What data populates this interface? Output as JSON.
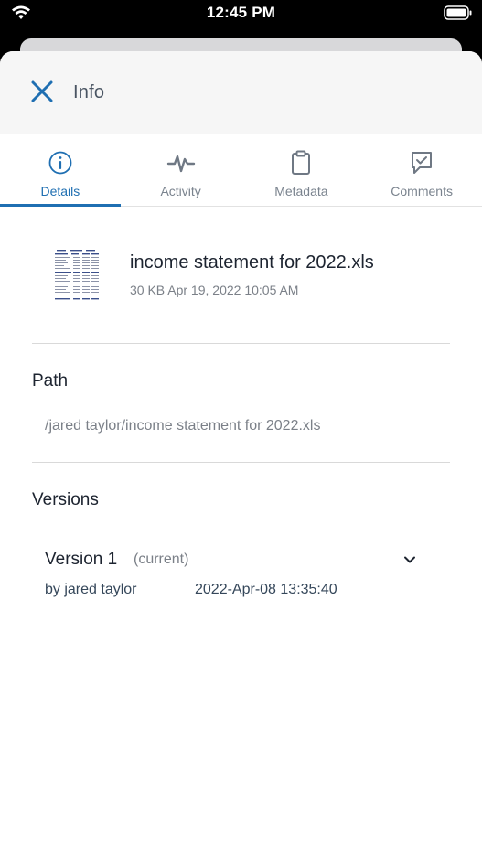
{
  "status_bar": {
    "time": "12:45 PM",
    "wifi_icon": "wifi-icon",
    "battery_icon": "battery-icon"
  },
  "header": {
    "title": "Info",
    "close_icon": "close-icon"
  },
  "tabs": [
    {
      "label": "Details",
      "icon": "info-icon",
      "active": true
    },
    {
      "label": "Activity",
      "icon": "activity-pulse-icon",
      "active": false
    },
    {
      "label": "Metadata",
      "icon": "clipboard-icon",
      "active": false
    },
    {
      "label": "Comments",
      "icon": "comment-check-icon",
      "active": false
    }
  ],
  "file": {
    "name": "income statement for 2022.xls",
    "meta": "30 KB Apr 19, 2022 10:05 AM",
    "thumbnail": "spreadsheet-thumbnail"
  },
  "path": {
    "title": "Path",
    "value": "/jared taylor/income statement for 2022.xls"
  },
  "versions": {
    "title": "Versions",
    "items": [
      {
        "name": "Version 1",
        "status": "(current)",
        "author": "by jared taylor",
        "date": "2022-Apr-08 13:35:40"
      }
    ]
  },
  "colors": {
    "accent": "#1f6fb2",
    "text_primary": "#1d2430",
    "text_muted": "#7b8088",
    "header_bg": "#f6f6f6"
  }
}
